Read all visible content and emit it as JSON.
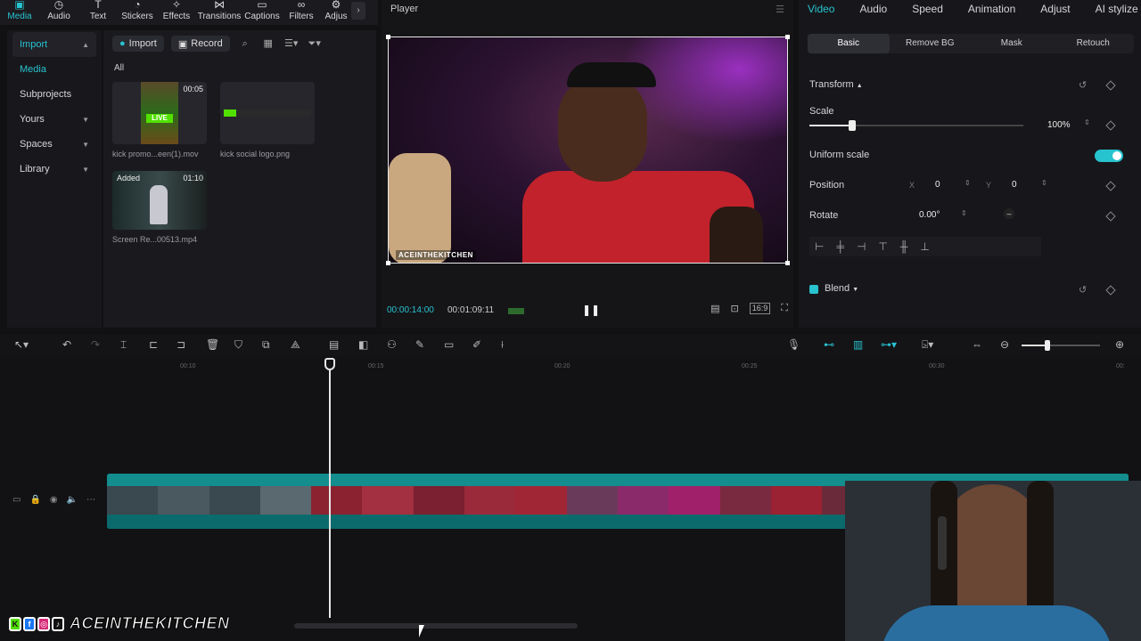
{
  "tool_tabs": [
    {
      "label": "Media",
      "icon": "media-icon",
      "active": true
    },
    {
      "label": "Audio",
      "icon": "audio-icon"
    },
    {
      "label": "Text",
      "icon": "text-icon"
    },
    {
      "label": "Stickers",
      "icon": "stickers-icon"
    },
    {
      "label": "Effects",
      "icon": "effects-icon"
    },
    {
      "label": "Transitions",
      "icon": "transitions-icon"
    },
    {
      "label": "Captions",
      "icon": "captions-icon"
    },
    {
      "label": "Filters",
      "icon": "filters-icon"
    },
    {
      "label": "Adjus",
      "icon": "adjust-icon"
    }
  ],
  "sidebar": {
    "import": "Import",
    "media": "Media",
    "subprojects": "Subprojects",
    "yours": "Yours",
    "spaces": "Spaces",
    "library": "Library"
  },
  "media_panel": {
    "import_btn": "Import",
    "record_btn": "Record",
    "filter_label": "All",
    "items": [
      {
        "name": "kick promo...een(1).mov",
        "duration": "00:05",
        "added": ""
      },
      {
        "name": "kick social logo.png",
        "duration": "",
        "added": ""
      },
      {
        "name": "Screen Re...00513.mp4",
        "duration": "01:10",
        "added": "Added"
      }
    ]
  },
  "player": {
    "title": "Player",
    "current_time": "00:00:14:00",
    "total_time": "00:01:09:11",
    "overlay_text": "ACEINTHEKITCHEN",
    "aspect": "16:9"
  },
  "props": {
    "tabs": [
      "Video",
      "Audio",
      "Speed",
      "Animation",
      "Adjust",
      "AI stylize"
    ],
    "active_tab": "Video",
    "subtabs": [
      "Basic",
      "Remove BG",
      "Mask",
      "Retouch"
    ],
    "active_subtab": "Basic",
    "transform_label": "Transform",
    "scale_label": "Scale",
    "scale_value": "100%",
    "scale_fraction": 0.2,
    "uniform_label": "Uniform scale",
    "position_label": "Position",
    "pos_x_label": "X",
    "pos_x": "0",
    "pos_y_label": "Y",
    "pos_y": "0",
    "rotate_label": "Rotate",
    "rotate_value": "0.00°",
    "rotate_extra": "–",
    "blend_label": "Blend"
  },
  "timeline": {
    "ticks": [
      "00:10",
      "00:15",
      "00:20",
      "00:25",
      "00:30",
      "00:"
    ]
  },
  "watermark": {
    "text": "ACEINTHEKITCHEN",
    "badges": [
      "K",
      "f",
      "◎",
      "♪"
    ]
  },
  "colors": {
    "accent": "#27c3cf",
    "clip": "#0f7f80"
  }
}
